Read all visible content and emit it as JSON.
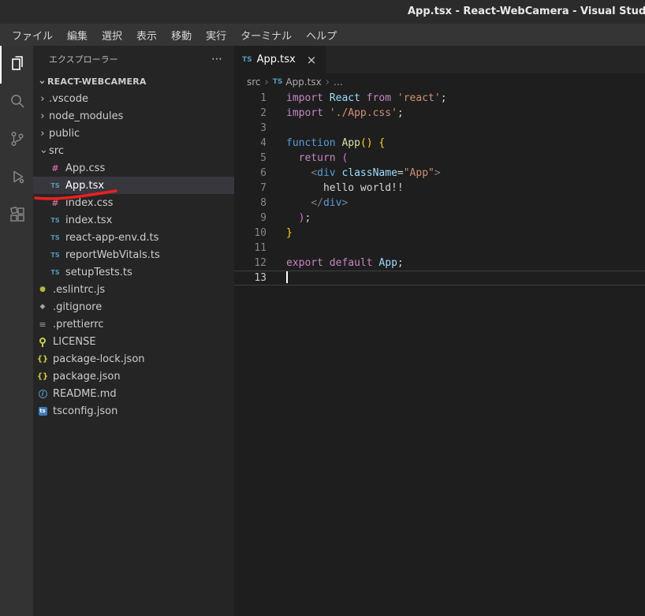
{
  "window": {
    "title": "App.tsx - React-WebCamera - Visual Studio Code"
  },
  "menu": {
    "items": [
      {
        "key": "file",
        "label": "ファイル"
      },
      {
        "key": "edit",
        "label": "編集"
      },
      {
        "key": "selection",
        "label": "選択"
      },
      {
        "key": "view",
        "label": "表示"
      },
      {
        "key": "go",
        "label": "移動"
      },
      {
        "key": "run",
        "label": "実行"
      },
      {
        "key": "terminal",
        "label": "ターミナル"
      },
      {
        "key": "help",
        "label": "ヘルプ"
      }
    ]
  },
  "activity_bar": {
    "items": [
      "explorer",
      "search",
      "source-control",
      "run-debug",
      "extensions"
    ],
    "active": "explorer"
  },
  "icons": {
    "chevron": "›",
    "more": "⋯",
    "breadcrumb_separator": "›",
    "css": "#",
    "ts": "TS",
    "json": "{}",
    "eslint": "●",
    "git": "◆",
    "prettier": "≡",
    "info": "i",
    "tsconfig": "ts",
    "license": ""
  },
  "sidebar": {
    "header": "エクスプローラー",
    "section": {
      "label": "REACT-WEBCAMERA",
      "expanded": true
    },
    "items": [
      {
        "label": ".vscode",
        "kind": "folder",
        "expanded": false,
        "level": 0
      },
      {
        "label": "node_modules",
        "kind": "folder",
        "expanded": false,
        "level": 0
      },
      {
        "label": "public",
        "kind": "folder",
        "expanded": false,
        "level": 0
      },
      {
        "label": "src",
        "kind": "folder",
        "expanded": true,
        "level": 0
      },
      {
        "label": "App.css",
        "kind": "file",
        "icon": "css",
        "level": 1
      },
      {
        "label": "App.tsx",
        "kind": "file",
        "icon": "ts",
        "level": 1,
        "selected": true
      },
      {
        "label": "index.css",
        "kind": "file",
        "icon": "css",
        "level": 1
      },
      {
        "label": "index.tsx",
        "kind": "file",
        "icon": "ts",
        "level": 1
      },
      {
        "label": "react-app-env.d.ts",
        "kind": "file",
        "icon": "ts",
        "level": 1
      },
      {
        "label": "reportWebVitals.ts",
        "kind": "file",
        "icon": "ts",
        "level": 1
      },
      {
        "label": "setupTests.ts",
        "kind": "file",
        "icon": "ts",
        "level": 1
      },
      {
        "label": ".eslintrc.js",
        "kind": "file",
        "icon": "eslint",
        "level": 0
      },
      {
        "label": ".gitignore",
        "kind": "file",
        "icon": "git",
        "level": 0
      },
      {
        "label": ".prettierrc",
        "kind": "file",
        "icon": "prettier",
        "level": 0
      },
      {
        "label": "LICENSE",
        "kind": "file",
        "icon": "license",
        "level": 0
      },
      {
        "label": "package-lock.json",
        "kind": "file",
        "icon": "json",
        "level": 0
      },
      {
        "label": "package.json",
        "kind": "file",
        "icon": "json",
        "level": 0
      },
      {
        "label": "README.md",
        "kind": "file",
        "icon": "info",
        "level": 0
      },
      {
        "label": "tsconfig.json",
        "kind": "file",
        "icon": "tsconfig",
        "level": 0
      }
    ]
  },
  "editor": {
    "tab": {
      "icon_label": "TS",
      "label": "App.tsx",
      "close_label": "×"
    },
    "breadcrumb": [
      {
        "label": "src"
      },
      {
        "label": "App.tsx",
        "icon": "ts"
      },
      {
        "label": "…"
      }
    ],
    "lines": [
      {
        "num": 1,
        "tokens": [
          {
            "s": "kw",
            "t": "import"
          },
          {
            "s": "pln",
            "t": " "
          },
          {
            "s": "var",
            "t": "React"
          },
          {
            "s": "pln",
            "t": " "
          },
          {
            "s": "kw",
            "t": "from"
          },
          {
            "s": "pln",
            "t": " "
          },
          {
            "s": "str",
            "t": "'react'"
          },
          {
            "s": "pln",
            "t": ";"
          }
        ]
      },
      {
        "num": 2,
        "tokens": [
          {
            "s": "kw",
            "t": "import"
          },
          {
            "s": "pln",
            "t": " "
          },
          {
            "s": "str",
            "t": "'./App.css'"
          },
          {
            "s": "pln",
            "t": ";"
          }
        ]
      },
      {
        "num": 3,
        "tokens": []
      },
      {
        "num": 4,
        "tokens": [
          {
            "s": "type",
            "t": "function"
          },
          {
            "s": "pln",
            "t": " "
          },
          {
            "s": "fn",
            "t": "App"
          },
          {
            "s": "b1",
            "t": "()"
          },
          {
            "s": "pln",
            "t": " "
          },
          {
            "s": "b1",
            "t": "{"
          }
        ]
      },
      {
        "num": 5,
        "tokens": [
          {
            "s": "pln",
            "t": "  "
          },
          {
            "s": "kw",
            "t": "return"
          },
          {
            "s": "pln",
            "t": " "
          },
          {
            "s": "b2",
            "t": "("
          }
        ]
      },
      {
        "num": 6,
        "tokens": [
          {
            "s": "pln",
            "t": "    "
          },
          {
            "s": "pun",
            "t": "<"
          },
          {
            "s": "tag",
            "t": "div"
          },
          {
            "s": "pln",
            "t": " "
          },
          {
            "s": "attr",
            "t": "className"
          },
          {
            "s": "pln",
            "t": "="
          },
          {
            "s": "str",
            "t": "\"App\""
          },
          {
            "s": "pun",
            "t": ">"
          }
        ]
      },
      {
        "num": 7,
        "tokens": [
          {
            "s": "pln",
            "t": "      hello world!!"
          }
        ]
      },
      {
        "num": 8,
        "tokens": [
          {
            "s": "pln",
            "t": "    "
          },
          {
            "s": "pun",
            "t": "</"
          },
          {
            "s": "tag",
            "t": "div"
          },
          {
            "s": "pun",
            "t": ">"
          }
        ]
      },
      {
        "num": 9,
        "tokens": [
          {
            "s": "pln",
            "t": "  "
          },
          {
            "s": "b2",
            "t": ")"
          },
          {
            "s": "pln",
            "t": ";"
          }
        ]
      },
      {
        "num": 10,
        "tokens": [
          {
            "s": "b1",
            "t": "}"
          }
        ]
      },
      {
        "num": 11,
        "tokens": []
      },
      {
        "num": 12,
        "tokens": [
          {
            "s": "kw",
            "t": "export"
          },
          {
            "s": "pln",
            "t": " "
          },
          {
            "s": "kw",
            "t": "default"
          },
          {
            "s": "pln",
            "t": " "
          },
          {
            "s": "var",
            "t": "App"
          },
          {
            "s": "pln",
            "t": ";"
          }
        ]
      },
      {
        "num": 13,
        "tokens": [],
        "current": true,
        "cursor": true
      }
    ]
  },
  "annotation": {
    "color": "#e8211f"
  }
}
